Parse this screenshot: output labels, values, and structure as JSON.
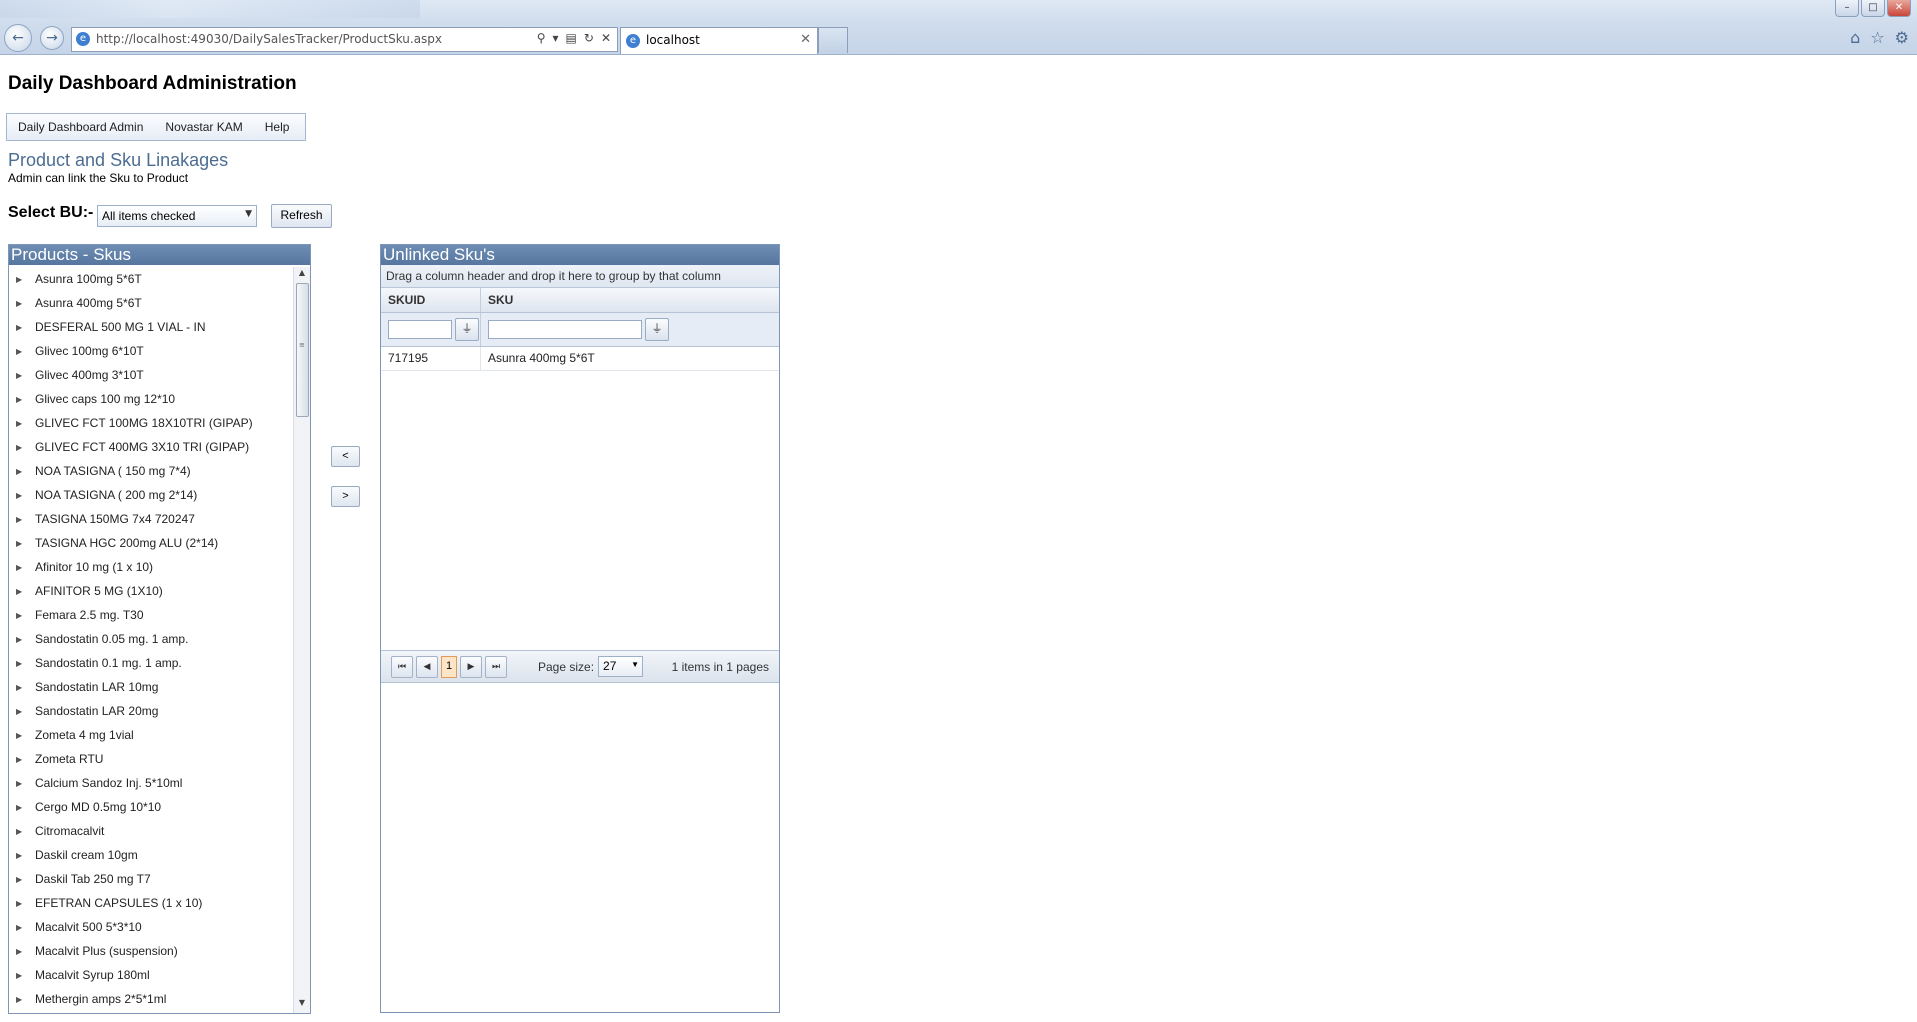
{
  "browser": {
    "url": "http://localhost:49030/DailySalesTracker/ProductSku.aspx",
    "tab_title": "localhost",
    "window_controls": [
      "–",
      "□",
      "✕"
    ]
  },
  "page": {
    "title": "Daily Dashboard Administration",
    "menu": [
      "Daily Dashboard Admin",
      "Novastar KAM",
      "Help"
    ],
    "section_title": "Product and Sku Linakages",
    "section_subtitle": "Admin can link the Sku to Product",
    "bu_label": "Select BU:-",
    "bu_combo_value": "All items checked",
    "refresh_label": "Refresh"
  },
  "products_panel": {
    "header": "Products - Skus",
    "items": [
      "Asunra 100mg 5*6T",
      "Asunra 400mg 5*6T",
      "DESFERAL 500 MG 1 VIAL - IN",
      "Glivec 100mg 6*10T",
      "Glivec 400mg 3*10T",
      "Glivec caps 100 mg 12*10",
      "GLIVEC FCT 100MG 18X10TRI (GIPAP)",
      "GLIVEC FCT 400MG 3X10 TRI (GIPAP)",
      "NOA TASIGNA ( 150 mg 7*4)",
      "NOA TASIGNA ( 200 mg 2*14)",
      "TASIGNA 150MG 7x4 720247",
      "TASIGNA HGC 200mg ALU (2*14)",
      "Afinitor 10 mg (1 x 10)",
      "AFINITOR 5 MG (1X10)",
      "Femara 2.5 mg. T30",
      "Sandostatin 0.05 mg. 1 amp.",
      "Sandostatin 0.1 mg. 1 amp.",
      "Sandostatin LAR 10mg",
      "Sandostatin LAR 20mg",
      "Zometa 4 mg 1vial",
      "Zometa RTU",
      "Calcium Sandoz Inj. 5*10ml",
      "Cergo MD 0.5mg 10*10",
      "Citromacalvit",
      "Daskil cream 10gm",
      "Daskil Tab 250 mg T7",
      "EFETRAN CAPSULES (1 x 10)",
      "Macalvit 500 5*3*10",
      "Macalvit Plus (suspension)",
      "Macalvit Syrup 180ml",
      "Methergin amps 2*5*1ml"
    ]
  },
  "move_buttons": {
    "left": "<",
    "right": ">"
  },
  "unlinked_panel": {
    "header": "Unlinked Sku's",
    "group_hint": "Drag a column header and drop it here to group by that column",
    "columns": [
      "SKUID",
      "SKU"
    ],
    "rows": [
      {
        "skuid": "717195",
        "sku": "Asunra 400mg 5*6T"
      }
    ],
    "pager": {
      "current_page": "1",
      "page_size_label": "Page size:",
      "page_size": "27",
      "info": "1 items in 1 pages"
    }
  }
}
